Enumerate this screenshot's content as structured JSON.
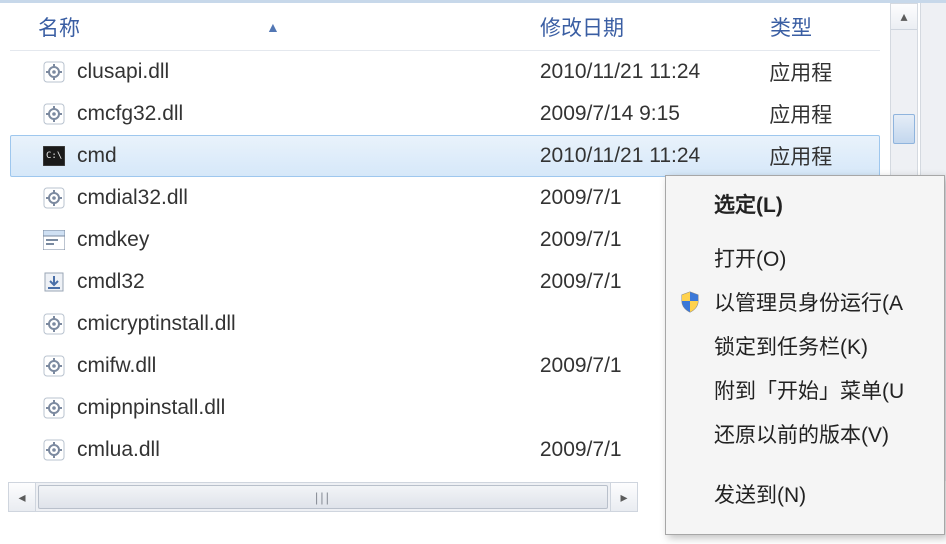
{
  "columns": {
    "name": "名称",
    "date": "修改日期",
    "type": "类型"
  },
  "files": [
    {
      "name": "clusapi.dll",
      "date": "2010/11/21 11:24",
      "type": "应用程",
      "icon": "gear"
    },
    {
      "name": "cmcfg32.dll",
      "date": "2009/7/14 9:15",
      "type": "应用程",
      "icon": "gear"
    },
    {
      "name": "cmd",
      "date": "2010/11/21 11:24",
      "type": "应用程",
      "icon": "console",
      "selected": true
    },
    {
      "name": "cmdial32.dll",
      "date": "2009/7/1",
      "type": "",
      "icon": "gear"
    },
    {
      "name": "cmdkey",
      "date": "2009/7/1",
      "type": "",
      "icon": "window"
    },
    {
      "name": "cmdl32",
      "date": "2009/7/1",
      "type": "",
      "icon": "download"
    },
    {
      "name": "cmicryptinstall.dll",
      "date": "",
      "type": "",
      "icon": "gear"
    },
    {
      "name": "cmifw.dll",
      "date": "2009/7/1",
      "type": "",
      "icon": "gear"
    },
    {
      "name": "cmipnpinstall.dll",
      "date": "",
      "type": "",
      "icon": "gear"
    },
    {
      "name": "cmlua.dll",
      "date": "2009/7/1",
      "type": "",
      "icon": "gear"
    }
  ],
  "context_menu": {
    "select": "选定(L)",
    "open": "打开(O)",
    "run_as_admin": "以管理员身份运行(A",
    "pin_taskbar": "锁定到任务栏(K)",
    "pin_start": "附到「开始」菜单(U",
    "restore": "还原以前的版本(V)",
    "send_to": "发送到(N)"
  }
}
